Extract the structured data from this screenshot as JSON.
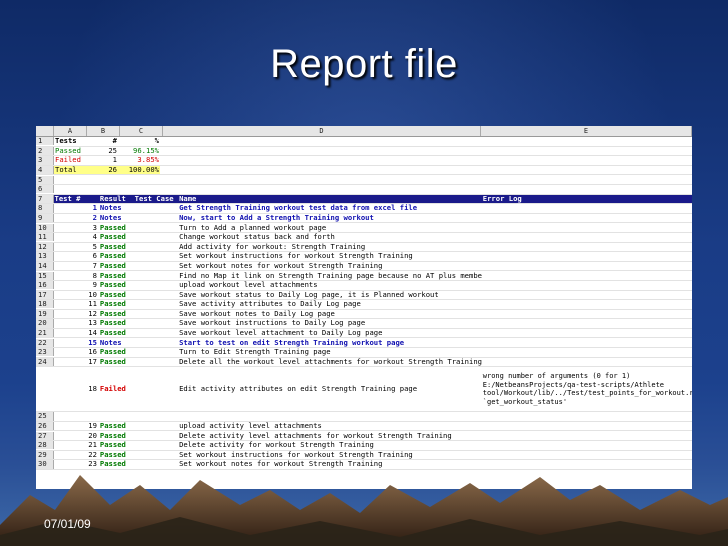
{
  "slide": {
    "title": "Report file",
    "date": "07/01/09"
  },
  "sheet": {
    "columns": [
      "A",
      "B",
      "C",
      "D",
      "E"
    ],
    "summary_header": {
      "row": "1",
      "a": "Tests",
      "b": "#",
      "c": "%"
    },
    "summary": [
      {
        "row": "2",
        "a": "Passed",
        "b": "25",
        "c": "96.15%"
      },
      {
        "row": "3",
        "a": "Failed",
        "b": "1",
        "c": "3.85%"
      },
      {
        "row": "4",
        "a": "Total",
        "b": "26",
        "c": "100.00%"
      }
    ],
    "blank_rows": [
      "5",
      "6"
    ],
    "table_header": {
      "row": "7",
      "num": "Test #",
      "result": "Result",
      "test_case": "Test Case",
      "name": "Name",
      "error_log": "Error Log"
    },
    "rows": [
      {
        "row": "8",
        "num": "1",
        "result": "Notes",
        "name": "Get Strength Training workout test data from excel file"
      },
      {
        "row": "9",
        "num": "2",
        "result": "Notes",
        "name": "Now, start to Add a Strength Training workout"
      },
      {
        "row": "10",
        "num": "3",
        "result": "Passed",
        "name": "Turn to Add a planned workout page"
      },
      {
        "row": "11",
        "num": "4",
        "result": "Passed",
        "name": "Change workout status back and forth"
      },
      {
        "row": "12",
        "num": "5",
        "result": "Passed",
        "name": "Add activity for workout: Strength Training"
      },
      {
        "row": "13",
        "num": "6",
        "result": "Passed",
        "name": "Set workout instructions for workout Strength Training"
      },
      {
        "row": "14",
        "num": "7",
        "result": "Passed",
        "name": "Set workout notes for workout Strength Training"
      },
      {
        "row": "15",
        "num": "8",
        "result": "Passed",
        "name": "Find no Map it link on Strength Training page because no AT plus membership."
      },
      {
        "row": "16",
        "num": "9",
        "result": "Passed",
        "name": "upload workout level attachments"
      },
      {
        "row": "17",
        "num": "10",
        "result": "Passed",
        "name": "Save workout status to Daily Log page, it is Planned workout"
      },
      {
        "row": "18",
        "num": "11",
        "result": "Passed",
        "name": "Save activity attributes to Daily Log page"
      },
      {
        "row": "19",
        "num": "12",
        "result": "Passed",
        "name": "Save workout notes to Daily Log page"
      },
      {
        "row": "20",
        "num": "13",
        "result": "Passed",
        "name": "Save workout instructions to Daily Log page"
      },
      {
        "row": "21",
        "num": "14",
        "result": "Passed",
        "name": "Save workout level attachment to Daily Log page"
      },
      {
        "row": "22",
        "num": "15",
        "result": "Notes",
        "name": "Start to test on edit Strength Training workout page"
      },
      {
        "row": "23",
        "num": "16",
        "result": "Passed",
        "name": "Turn to Edit Strength Training page"
      },
      {
        "row": "24",
        "num": "17",
        "result": "Passed",
        "name": "Delete all the workout level attachments for workout Strength Training"
      }
    ],
    "failed_row": {
      "row": "",
      "num": "18",
      "result": "Failed",
      "name": "Edit activity attributes on edit  Strength Training page",
      "error_lines": [
        "wrong number of arguments (0 for 1)",
        "E:/NetbeansProjects/qa-test-scripts/Athlete",
        "tool/Workout/lib/../Test/test_points_for_workout.rb:195:in",
        "`get_workout_status'"
      ]
    },
    "row_25": "25",
    "rows_after": [
      {
        "row": "26",
        "num": "19",
        "result": "Passed",
        "name": "upload activity level attachments"
      },
      {
        "row": "27",
        "num": "20",
        "result": "Passed",
        "name": "Delete activity level attachments for workout Strength Training"
      },
      {
        "row": "28",
        "num": "21",
        "result": "Passed",
        "name": "Delete activity for workout Strength Training"
      },
      {
        "row": "29",
        "num": "22",
        "result": "Passed",
        "name": "Set workout instructions for workout Strength Training"
      },
      {
        "row": "30",
        "num": "23",
        "result": "Passed",
        "name": "Set workout notes for workout Strength Training"
      }
    ]
  }
}
